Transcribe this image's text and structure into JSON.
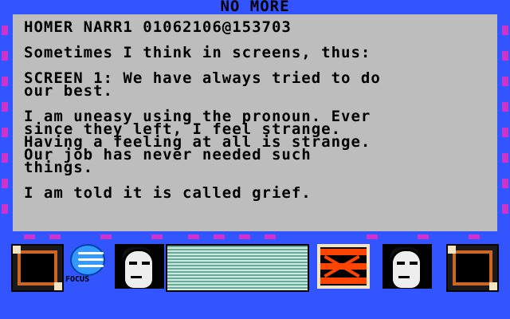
{
  "screen_title": "NO MORE",
  "document": {
    "header": "HOMER NARR1 01062106@153703",
    "paragraphs": [
      "Sometimes I think in screens, thus:",
      "SCREEN 1: We have always tried to do\nour best.",
      "I am uneasy using the pronoun. Ever\nsince they left, I feel strange.\nHaving a feeling at all is strange.\nOur job has never needed such\nthings.",
      "I am told it is called grief."
    ]
  },
  "hud": {
    "focus_label": "FOCUS"
  },
  "colors": {
    "background_blue": "#3355ff",
    "panel_gray": "#bdbdbd",
    "accent_magenta": "#cc33cc",
    "alert_red": "#ff4400",
    "grate_teal": "#66aa99"
  },
  "icons": {
    "left_frame": "picture-frame-icon",
    "focus": "globe-icon",
    "portrait_left": "robot-face-icon",
    "screen": "grate-screen-icon",
    "alert": "red-x-panel-icon",
    "portrait_right": "robot-face-icon",
    "right_frame": "picture-frame-icon"
  }
}
